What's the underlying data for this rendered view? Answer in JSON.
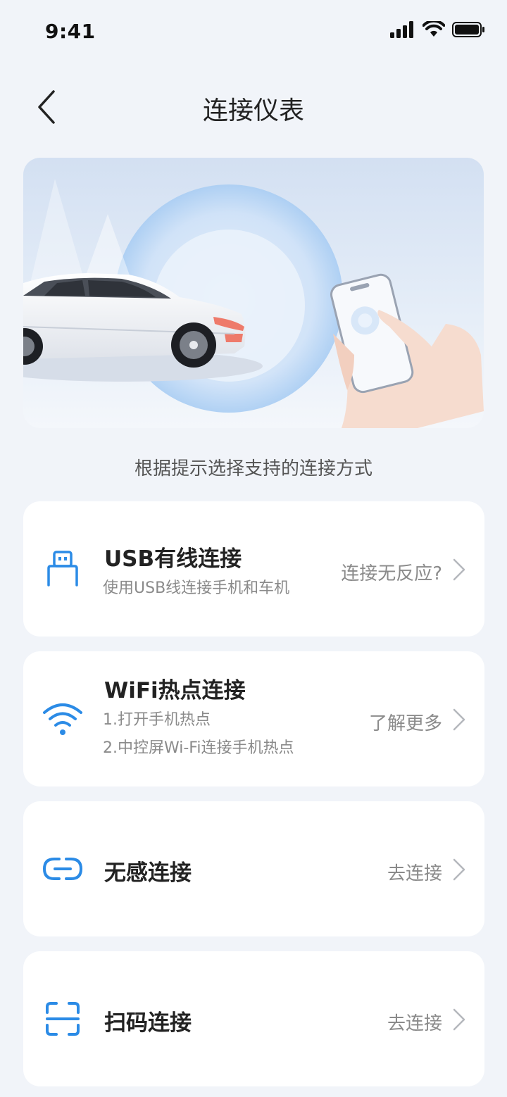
{
  "status": {
    "time": "9:41"
  },
  "nav": {
    "title": "连接仪表"
  },
  "hint": "根据提示选择支持的连接方式",
  "options": [
    {
      "title": "USB有线连接",
      "desc": [
        "使用USB线连接手机和车机"
      ],
      "action": "连接无反应?",
      "icon": "usb-icon"
    },
    {
      "title": "WiFi热点连接",
      "desc": [
        "1.打开手机热点",
        "2.中控屏Wi-Fi连接手机热点"
      ],
      "action": "了解更多",
      "icon": "wifi-icon"
    },
    {
      "title": "无感连接",
      "desc": [],
      "action": "去连接",
      "icon": "link-icon"
    },
    {
      "title": "扫码连接",
      "desc": [],
      "action": "去连接",
      "icon": "scan-icon"
    }
  ],
  "colors": {
    "accent": "#2b8be6",
    "background": "#f1f4f9",
    "card": "#ffffff"
  }
}
